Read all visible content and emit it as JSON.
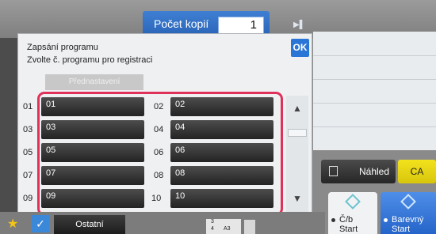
{
  "header": {
    "copies_label": "Počet kopií",
    "copies_value": "1"
  },
  "dialog": {
    "title": "Zapsání programu",
    "subtitle": "Zvolte č. programu pro registraci",
    "ok_label": "OK",
    "preset_label": "Přednastavení",
    "programs": [
      {
        "number": "01",
        "label": "01"
      },
      {
        "number": "02",
        "label": "02"
      },
      {
        "number": "03",
        "label": "03"
      },
      {
        "number": "04",
        "label": "04"
      },
      {
        "number": "05",
        "label": "05"
      },
      {
        "number": "06",
        "label": "06"
      },
      {
        "number": "07",
        "label": "07"
      },
      {
        "number": "08",
        "label": "08"
      },
      {
        "number": "09",
        "label": "09"
      },
      {
        "number": "10",
        "label": "10"
      }
    ]
  },
  "right": {
    "preview_label": "Náhled",
    "ca_label": "CA"
  },
  "start": {
    "bw_line1": "Č/b",
    "bw_line2": "Start",
    "color_line1": "Barevný",
    "color_line2": "Start"
  },
  "bottom": {
    "other_label": "Ostatní",
    "paper_tray_top": "3",
    "paper_tray": "4",
    "paper_size": "A3"
  },
  "colors": {
    "accent": "#2a76d6",
    "highlight_frame": "#e0315a",
    "ca": "#f2e21d"
  },
  "icons": [
    "star-icon",
    "checkmark-icon",
    "play-icon",
    "scroll-up-icon",
    "scroll-down-icon",
    "preview-icon",
    "start-diamond-icon"
  ]
}
